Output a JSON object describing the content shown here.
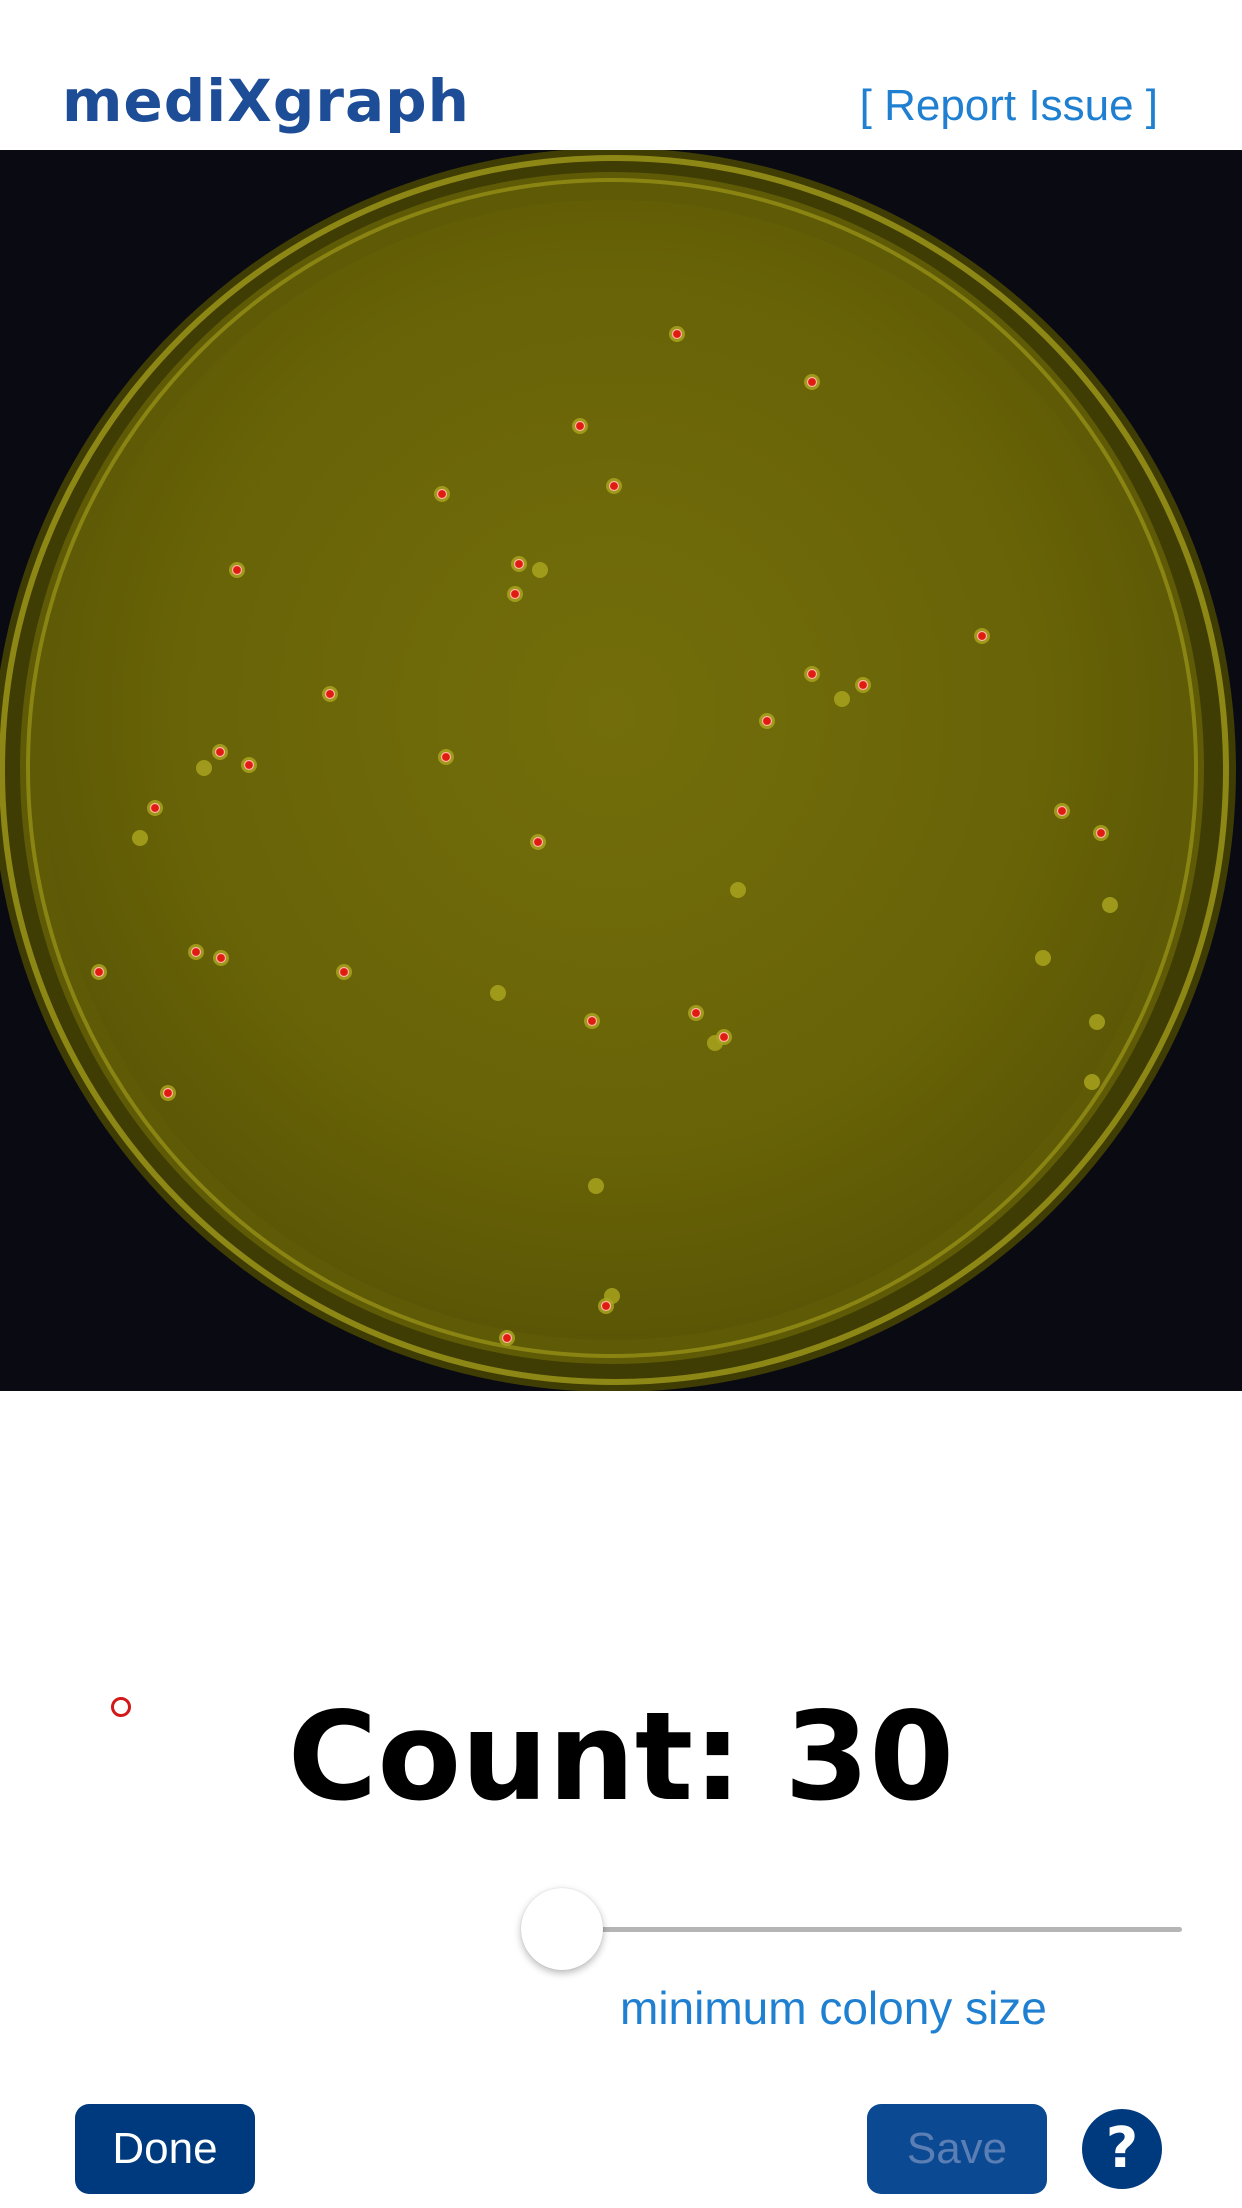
{
  "header": {
    "logo_text": "mediXgraph",
    "report_issue_label": "[ Report Issue ]"
  },
  "result": {
    "count_text": "Count: 30",
    "count": 30
  },
  "slider": {
    "label": "minimum colony size",
    "value_fraction": 0.0
  },
  "buttons": {
    "done_label": "Done",
    "save_label": "Save",
    "help_label": "?"
  },
  "colors": {
    "brand_blue": "#1e4d97",
    "link_blue": "#1f7fd1",
    "button_blue": "#003a7e",
    "marker_red": "#d21818",
    "agar_yellow": "#6e6a08"
  }
}
